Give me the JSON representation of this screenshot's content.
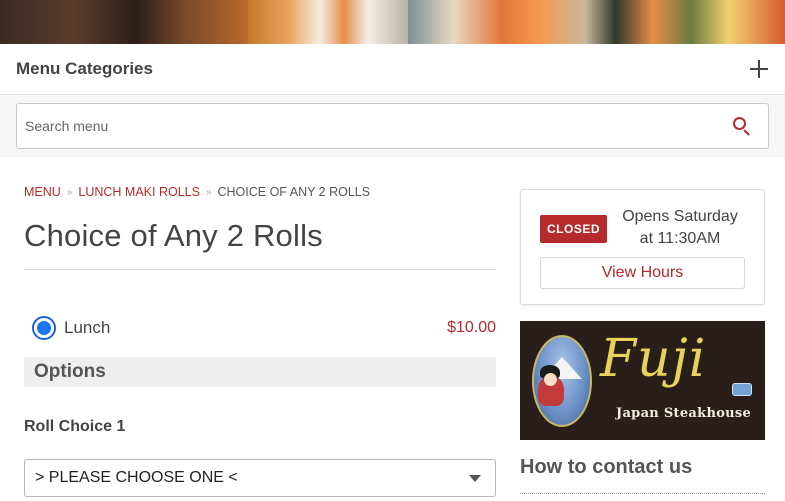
{
  "banner": {
    "alt": ""
  },
  "categories": {
    "title": "Menu Categories",
    "toggle_icon": "plus-icon"
  },
  "search": {
    "placeholder": "Search menu",
    "icon": "search-icon"
  },
  "breadcrumb": {
    "items": [
      {
        "label": "MENU"
      },
      {
        "label": "LUNCH MAKI ROLLS"
      }
    ],
    "current": "CHOICE OF ANY 2 ROLLS",
    "separator": "»"
  },
  "item": {
    "title": "Choice of Any 2 Rolls",
    "size_label": "Lunch",
    "price": "$10.00",
    "selected": true
  },
  "options": {
    "header": "Options",
    "choices": [
      {
        "label": "Roll Choice 1",
        "selected_value": "> PLEASE CHOOSE ONE <"
      }
    ]
  },
  "hours": {
    "status": "CLOSED",
    "opens_line1": "Opens Saturday",
    "opens_line2": "at 11:30AM",
    "button_label": "View Hours"
  },
  "logo": {
    "brand": "Fuji",
    "subtitle": "Japan Steakhouse"
  },
  "contact": {
    "title": "How to contact us"
  },
  "colors": {
    "accent": "#b52a2a",
    "radio": "#1d75f0",
    "text": "#444444"
  }
}
